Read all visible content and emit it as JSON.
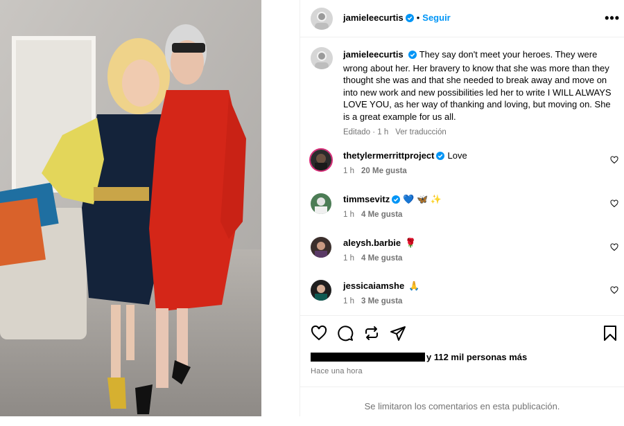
{
  "post": {
    "author": "jamieleecurtis",
    "follow_label": "Seguir",
    "separator": "•",
    "more_label": "•••",
    "caption": "They say don't meet your heroes. They were wrong about her. Her bravery to know that she was more than they thought she was and that she needed to break away and move on into new work and new possibilities led her to write I WILL ALWAYS LOVE YOU, as her way of thanking and loving, but moving on. She is a great example for us all.",
    "caption_meta": "Editado · 1 h",
    "translate_label": "Ver traducción"
  },
  "comments": [
    {
      "user": "thetylermerrittproject",
      "verified": true,
      "text": "Love",
      "time": "1 h",
      "likes": "20 Me gusta"
    },
    {
      "user": "timmsevitz",
      "verified": true,
      "text": "💙 🦋 ✨",
      "time": "1 h",
      "likes": "4 Me gusta"
    },
    {
      "user": "aleysh.barbie",
      "verified": false,
      "text": "🌹",
      "time": "1 h",
      "likes": "4 Me gusta"
    },
    {
      "user": "jessicaiamshe",
      "verified": false,
      "text": "🙏",
      "time": "1 h",
      "likes": "3 Me gusta"
    }
  ],
  "footer": {
    "likes_text": "y 112 mil personas más",
    "timestamp": "Hace una hora",
    "comments_limited": "Se limitaron los comentarios en esta publicación."
  },
  "icons": {
    "like": "heart-icon",
    "comment": "comment-icon",
    "share": "share-icon",
    "send": "send-icon",
    "save": "bookmark-icon",
    "verified_color": "#0095f6"
  }
}
